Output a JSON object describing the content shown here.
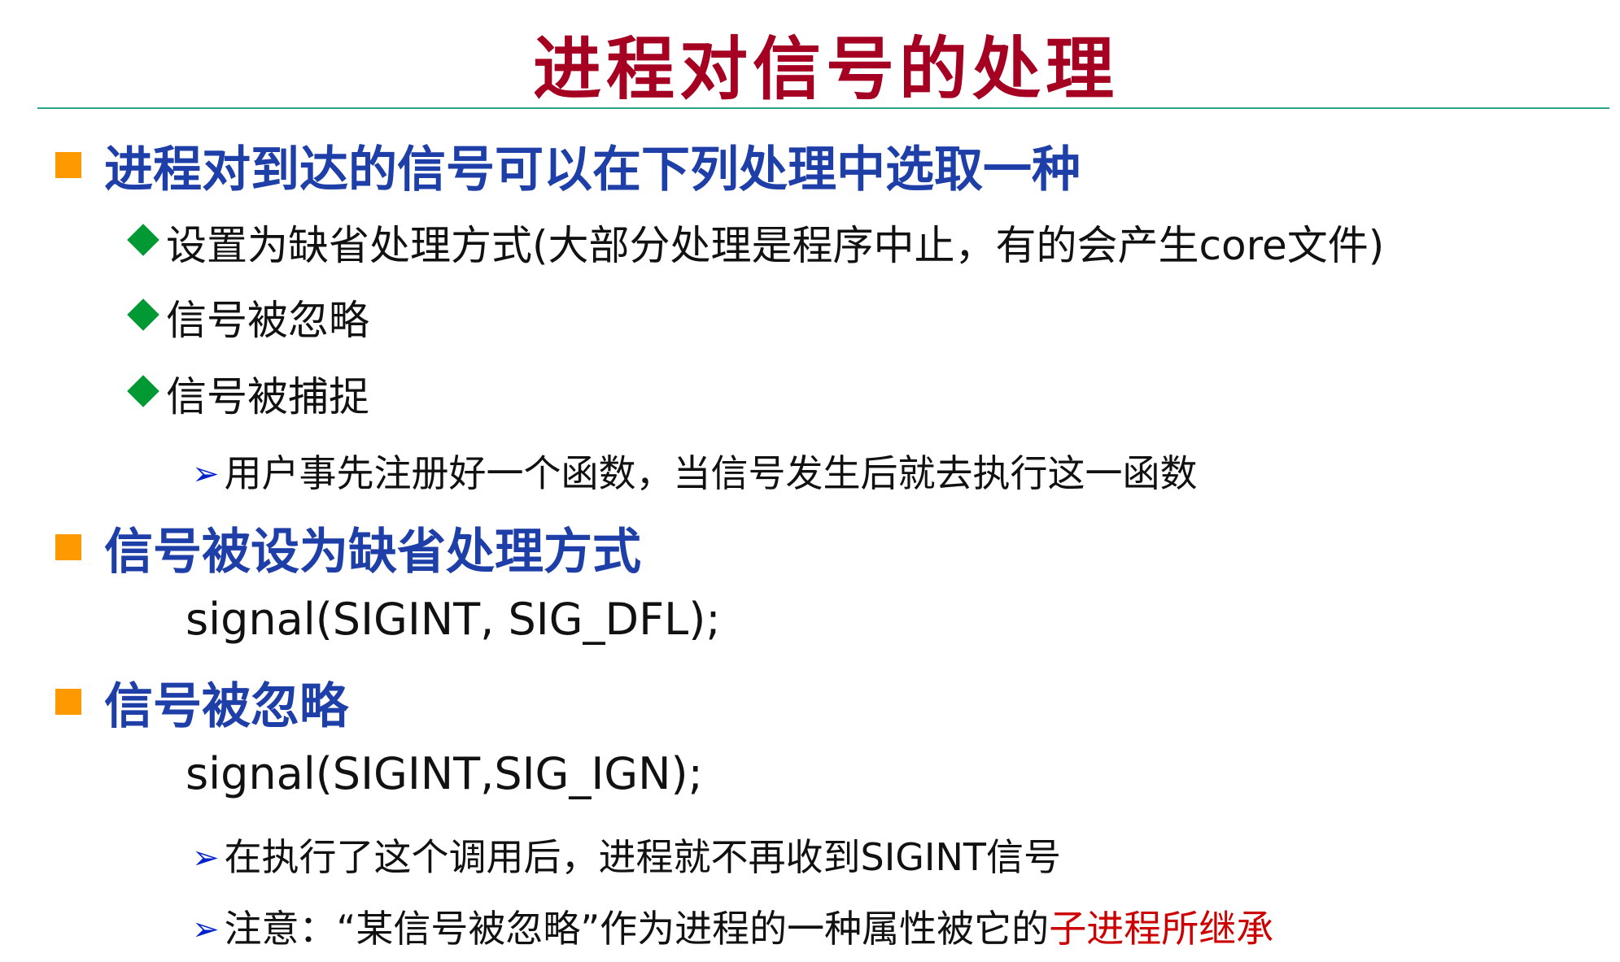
{
  "title": "进程对信号的处理",
  "colors": {
    "title": "#a50021",
    "heading": "#1f3fa8",
    "square_bullet": "#ff9900",
    "diamond_bullet": "#009933",
    "arrow_bullet": "#0022cc",
    "highlight": "#cc0000",
    "rule": "#2aa68a"
  },
  "sections": [
    {
      "heading": "进程对到达的信号可以在下列处理中选取一种",
      "items": [
        "设置为缺省处理方式(大部分处理是程序中止，有的会产生core文件)",
        "信号被忽略",
        "信号被捕捉"
      ],
      "sub_items": [
        "用户事先注册好一个函数，当信号发生后就去执行这一函数"
      ]
    },
    {
      "heading": "信号被设为缺省处理方式",
      "code": "signal(SIGINT, SIG_DFL);"
    },
    {
      "heading": "信号被忽略",
      "code": "signal(SIGINT,SIG_IGN);",
      "sub_items": [
        "在执行了这个调用后，进程就不再收到SIGINT信号",
        {
          "text": "注意：“某信号被忽略”作为进程的一种属性被它的",
          "highlight": "子进程所继承"
        }
      ]
    }
  ]
}
